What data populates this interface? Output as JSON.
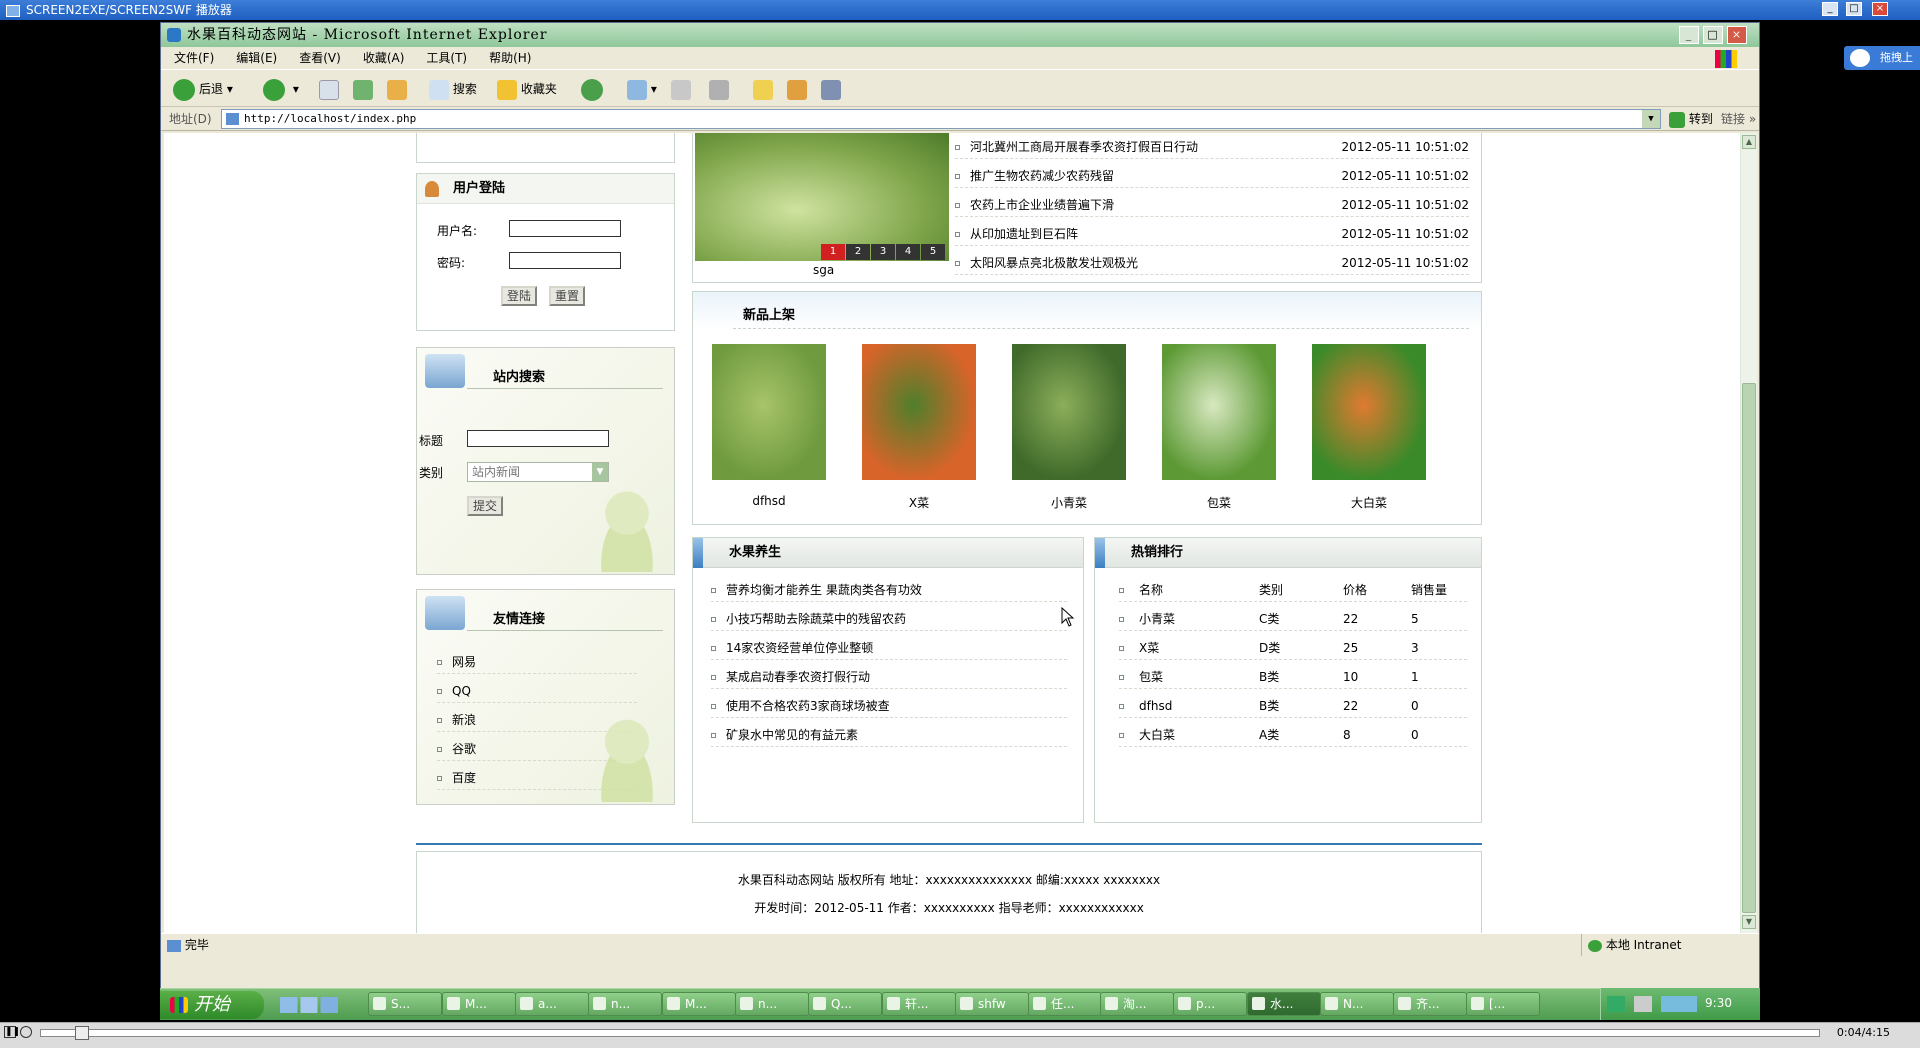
{
  "player": {
    "title": "SCREEN2EXE/SCREEN2SWF 播放器",
    "time": "0:04/4:15"
  },
  "ie": {
    "title": "水果百科动态网站 - Microsoft Internet Explorer",
    "menu": [
      "文件(F)",
      "编辑(E)",
      "查看(V)",
      "收藏(A)",
      "工具(T)",
      "帮助(H)"
    ],
    "toolbar": {
      "back": "后退",
      "search": "搜索",
      "favorites": "收藏夹"
    },
    "address": {
      "label": "地址(D)",
      "url": "http://localhost/index.php",
      "go": "转到",
      "links": "链接"
    },
    "status": {
      "left": "完毕",
      "zone": "本地 Intranet"
    }
  },
  "side_widget": "拖拽上",
  "slider": {
    "pages": [
      "1",
      "2",
      "3",
      "4",
      "5"
    ],
    "caption": "sga"
  },
  "top_news": [
    {
      "title": "河北冀州工商局开展春季农资打假百日行动",
      "date": "2012-05-11  10:51:02"
    },
    {
      "title": "推广生物农药减少农药残留",
      "date": "2012-05-11  10:51:02"
    },
    {
      "title": "农药上市企业业绩普遍下滑",
      "date": "2012-05-11  10:51:02"
    },
    {
      "title": "从印加遗址到巨石阵",
      "date": "2012-05-11  10:51:02"
    },
    {
      "title": "太阳风暴点亮北极散发壮观极光",
      "date": "2012-05-11  10:51:02"
    }
  ],
  "login": {
    "title": "用户登陆",
    "user_label": "用户名:",
    "pass_label": "密码:",
    "login_btn": "登陆",
    "reset_btn": "重置"
  },
  "search": {
    "title": "站内搜索",
    "title_label": "标题",
    "type_label": "类别",
    "type_value": "站内新闻",
    "submit": "提交"
  },
  "links": {
    "title": "友情连接",
    "items": [
      "网易",
      "QQ",
      "新浪",
      "谷歌",
      "百度"
    ]
  },
  "new_products": {
    "title": "新品上架",
    "items": [
      {
        "name": "dfhsd",
        "colors": [
          "#6f9a3e",
          "#a8c46a"
        ]
      },
      {
        "name": "X菜",
        "colors": [
          "#d8642a",
          "#4f7f2b"
        ]
      },
      {
        "name": "小青菜",
        "colors": [
          "#3f6a2a",
          "#8cae5a"
        ]
      },
      {
        "name": "包菜",
        "colors": [
          "#5d9a35",
          "#d8e8c0"
        ]
      },
      {
        "name": "大白菜",
        "colors": [
          "#3a8a2a",
          "#e07a30"
        ]
      }
    ]
  },
  "health": {
    "title": "水果养生",
    "items": [
      "营养均衡才能养生 果蔬肉类各有功效",
      "小技巧帮助去除蔬菜中的残留农药",
      "14家农资经营单位停业整顿",
      "某成启动春季农资打假行动",
      "使用不合格农药3家商球场被查",
      "矿泉水中常见的有益元素"
    ]
  },
  "hot": {
    "title": "热销排行",
    "headers": [
      "名称",
      "类别",
      "价格",
      "销售量"
    ],
    "rows": [
      [
        "小青菜",
        "C类",
        "22",
        "5"
      ],
      [
        "X菜",
        "D类",
        "25",
        "3"
      ],
      [
        "包菜",
        "B类",
        "10",
        "1"
      ],
      [
        "dfhsd",
        "B类",
        "22",
        "0"
      ],
      [
        "大白菜",
        "A类",
        "8",
        "0"
      ]
    ]
  },
  "footer": {
    "line1": "水果百科动态网站 版权所有 地址：xxxxxxxxxxxxxxx 邮编:xxxxx xxxxxxxx",
    "line2": "开发时间：2012-05-11 作者：xxxxxxxxxx 指导老师：xxxxxxxxxxxx"
  },
  "taskbar": {
    "start": "开始",
    "tasks": [
      "S...",
      "M...",
      "a...",
      "n...",
      "M...",
      "n...",
      "Q...",
      "轩...",
      "shfw",
      "任...",
      "淘...",
      "p...",
      "水...",
      "N...",
      "齐...",
      "[..."
    ],
    "clock": "9:30"
  }
}
